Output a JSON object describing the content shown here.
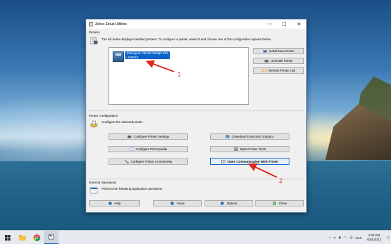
{
  "window": {
    "title": "Zebra Setup Utilities",
    "controls": {
      "minimize": "—",
      "maximize": "☐",
      "close": "✕"
    }
  },
  "printers": {
    "section_label": "Printers",
    "hint": "The list below displays installed printers. To configure a printer, select it and choose one of the configuration options below.",
    "selected_printer": {
      "name": "ZDesigner ZD420-203dpi ZPL",
      "port": "USB001"
    },
    "buttons": {
      "install": "Install New Printer",
      "uninstall": "Uninstall Printer",
      "refresh": "Refresh Printer List"
    }
  },
  "printer_configuration": {
    "section_label": "Printer Configuration",
    "hint": "Configure the selected printer",
    "buttons": {
      "configure_settings": "Configure Printer Settings",
      "download_fonts": "Download Fonts and Graphics",
      "print_quality": "Configure Print Quality",
      "printer_tools": "Open Printer Tools",
      "connectivity": "Configure Printer Connectivity",
      "open_communication": "Open Communication With Printer"
    }
  },
  "general_operations": {
    "section_label": "General Operations",
    "hint": "Perform the following application operations",
    "buttons": {
      "help": "Help",
      "about": "About",
      "options": "Options",
      "close": "Close"
    }
  },
  "annotations": {
    "first": "1",
    "second": "2",
    "color": "#e0261c"
  },
  "taskbar": {
    "tray": {
      "language": "NLD",
      "time": "3:00 PM",
      "date": "6/16/2022"
    }
  }
}
